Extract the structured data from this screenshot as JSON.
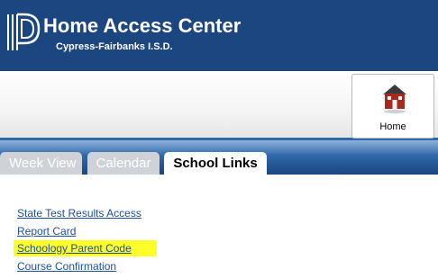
{
  "header": {
    "title": "Home Access Center",
    "district": "Cypress-Fairbanks I.S.D."
  },
  "toolbar": {
    "home_label": "Home"
  },
  "tabs": [
    {
      "label": "Week View",
      "active": false
    },
    {
      "label": "Calendar",
      "active": false
    },
    {
      "label": "School Links",
      "active": true
    }
  ],
  "links": [
    {
      "label": "State Test Results Access",
      "highlighted": false
    },
    {
      "label": "Report Card",
      "highlighted": false
    },
    {
      "label": "Schoology Parent Code",
      "highlighted": true
    },
    {
      "label": "Course Confirmation",
      "highlighted": false
    }
  ],
  "colors": {
    "header_bg": "#1b4680",
    "link": "#1a4f9c",
    "highlight": "#ffff29",
    "tab_inactive": "#cfd3d7"
  },
  "icons": [
    "logo-icon",
    "home-icon"
  ]
}
